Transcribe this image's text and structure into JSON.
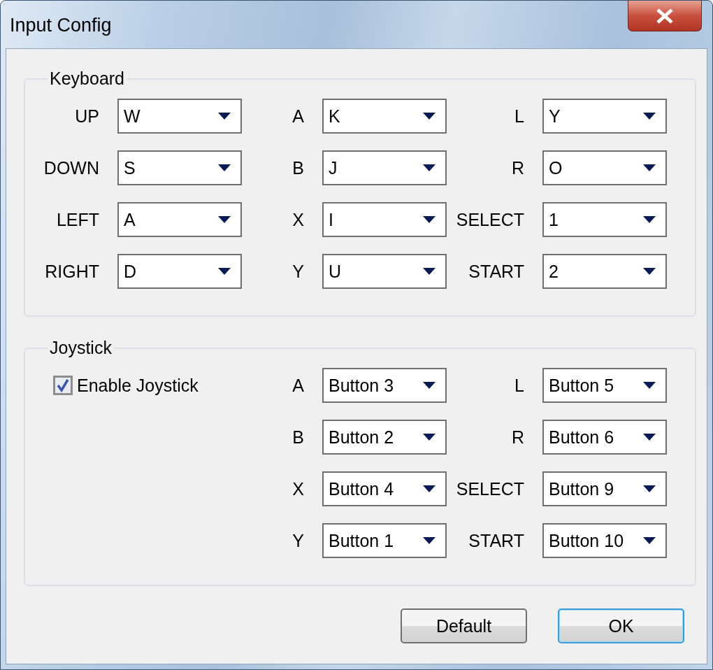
{
  "window": {
    "title": "Input Config"
  },
  "keyboard": {
    "title": "Keyboard",
    "rows": [
      [
        {
          "label": "UP",
          "value": "W"
        },
        {
          "label": "A",
          "value": "K"
        },
        {
          "label": "L",
          "value": "Y"
        }
      ],
      [
        {
          "label": "DOWN",
          "value": "S"
        },
        {
          "label": "B",
          "value": "J"
        },
        {
          "label": "R",
          "value": "O"
        }
      ],
      [
        {
          "label": "LEFT",
          "value": "A"
        },
        {
          "label": "X",
          "value": "I"
        },
        {
          "label": "SELECT",
          "value": "1"
        }
      ],
      [
        {
          "label": "RIGHT",
          "value": "D"
        },
        {
          "label": "Y",
          "value": "U"
        },
        {
          "label": "START",
          "value": "2"
        }
      ]
    ]
  },
  "joystick": {
    "title": "Joystick",
    "enable": {
      "label": "Enable Joystick",
      "checked": true
    },
    "rows": [
      [
        {
          "label": "A",
          "value": "Button 3"
        },
        {
          "label": "L",
          "value": "Button 5"
        }
      ],
      [
        {
          "label": "B",
          "value": "Button 2"
        },
        {
          "label": "R",
          "value": "Button 6"
        }
      ],
      [
        {
          "label": "X",
          "value": "Button 4"
        },
        {
          "label": "SELECT",
          "value": "Button 9"
        }
      ],
      [
        {
          "label": "Y",
          "value": "Button 1"
        },
        {
          "label": "START",
          "value": "Button 10"
        }
      ]
    ]
  },
  "buttons": [
    {
      "label": "Default",
      "focused": false
    },
    {
      "label": "OK",
      "focused": true
    }
  ]
}
